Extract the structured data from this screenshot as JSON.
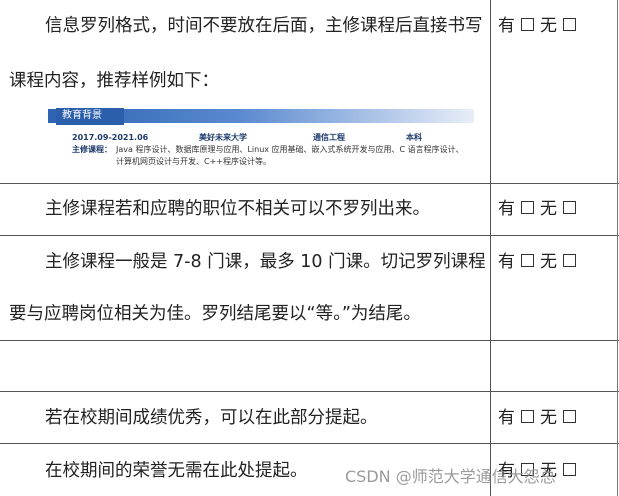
{
  "rows": [
    {
      "line1": "信息罗列格式，时间不要放在后面，主修课程后直接书写",
      "line2": "课程内容，推荐样例如下：",
      "option": {
        "yes": "有",
        "no": "无"
      }
    },
    {
      "line1": "主修课程若和应聘的职位不相关可以不罗列出来。",
      "option": {
        "yes": "有",
        "no": "无"
      }
    },
    {
      "line1": "主修课程一般是 7-8 门课，最多 10 门课。切记罗列课程",
      "line2": "要与应聘岗位相关为佳。罗列结尾要以“等。”为结尾。",
      "option": {
        "yes": "有",
        "no": "无"
      }
    },
    {
      "line1": "",
      "option": null
    },
    {
      "line1": "若在校期间成绩优秀，可以在此部分提起。",
      "option": {
        "yes": "有",
        "no": "无"
      }
    },
    {
      "line1": "在校期间的荣誉无需在此处提起。",
      "option": {
        "yes": "有",
        "no": "无"
      }
    }
  ],
  "sample": {
    "section_title": "教育背景",
    "date_range": "2017.09-2021.06",
    "school": "美好未来大学",
    "major": "通信工程",
    "degree": "本科",
    "courses_label": "主修课程：",
    "courses_line1": "Java 程序设计、数据库原理与应用、Linux 应用基础、嵌入式系统开发与应用、C 语言程序设计、",
    "courses_line2": "计算机网页设计与开发、C++程序设计等。"
  },
  "watermark": "CSDN @师范大学通信大怨总"
}
